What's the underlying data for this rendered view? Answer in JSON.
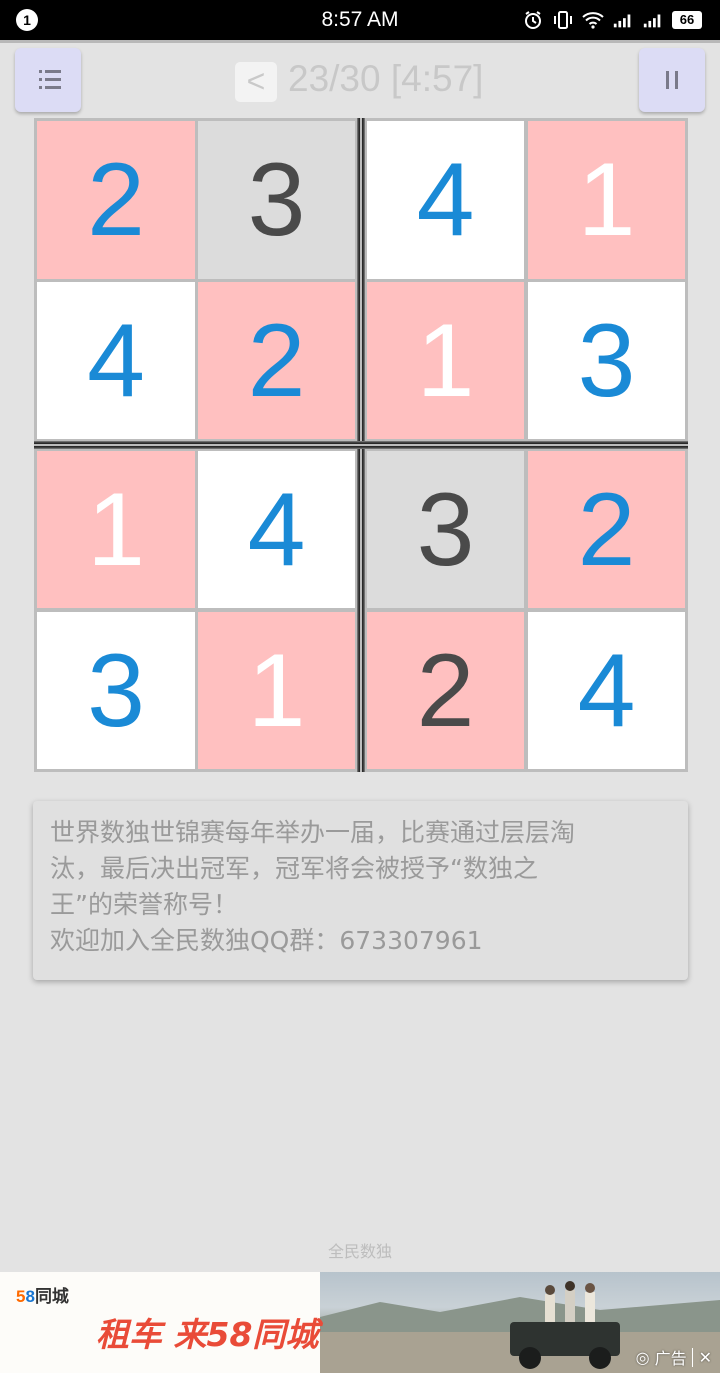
{
  "status_bar": {
    "notification_count": "1",
    "time": "8:57 AM",
    "battery": "66",
    "icons": [
      "alarm-icon",
      "vibrate-icon",
      "wifi-icon",
      "signal-icon",
      "signal-icon",
      "battery-icon"
    ]
  },
  "toolbar": {
    "back_label": "<",
    "progress": "23/30 [4:57]",
    "menu_icon": "list-icon",
    "pause_icon": "pause-icon"
  },
  "board": {
    "rows": [
      [
        {
          "value": "2",
          "bg": "pink",
          "color": "blue"
        },
        {
          "value": "3",
          "bg": "gray",
          "color": "dark"
        },
        {
          "value": "4",
          "bg": "white",
          "color": "blue"
        },
        {
          "value": "1",
          "bg": "pink",
          "color": "white"
        }
      ],
      [
        {
          "value": "4",
          "bg": "white",
          "color": "blue"
        },
        {
          "value": "2",
          "bg": "pink",
          "color": "blue"
        },
        {
          "value": "1",
          "bg": "pink",
          "color": "white"
        },
        {
          "value": "3",
          "bg": "white",
          "color": "blue"
        }
      ],
      [
        {
          "value": "1",
          "bg": "pink",
          "color": "white"
        },
        {
          "value": "4",
          "bg": "white",
          "color": "blue"
        },
        {
          "value": "3",
          "bg": "gray",
          "color": "dark"
        },
        {
          "value": "2",
          "bg": "pink",
          "color": "blue"
        }
      ],
      [
        {
          "value": "3",
          "bg": "white",
          "color": "blue"
        },
        {
          "value": "1",
          "bg": "pink",
          "color": "white"
        },
        {
          "value": "2",
          "bg": "pink",
          "color": "dark"
        },
        {
          "value": "4",
          "bg": "white",
          "color": "blue"
        }
      ]
    ]
  },
  "info": {
    "line1": "世界数独世锦赛每年举办一届，比赛通过层层淘",
    "line2": "汰，最后决出冠军，冠军将会被授予“数独之",
    "line3": "王”的荣誉称号！",
    "line4": "欢迎加入全民数独QQ群：673307961"
  },
  "footer": {
    "app_name": "全民数独"
  },
  "ad": {
    "logo_digit_5": "5",
    "logo_digit_8": "8",
    "logo_name": "同城",
    "slogan": "租车 来58同城",
    "label": "广告",
    "close": "✕"
  },
  "colors": {
    "pink": "#ffc0c0",
    "white": "#ffffff",
    "gray": "#dcdcdc",
    "blue": "#1a8ad6",
    "dark": "#4a4a4a",
    "button": "#dcdcf5"
  }
}
